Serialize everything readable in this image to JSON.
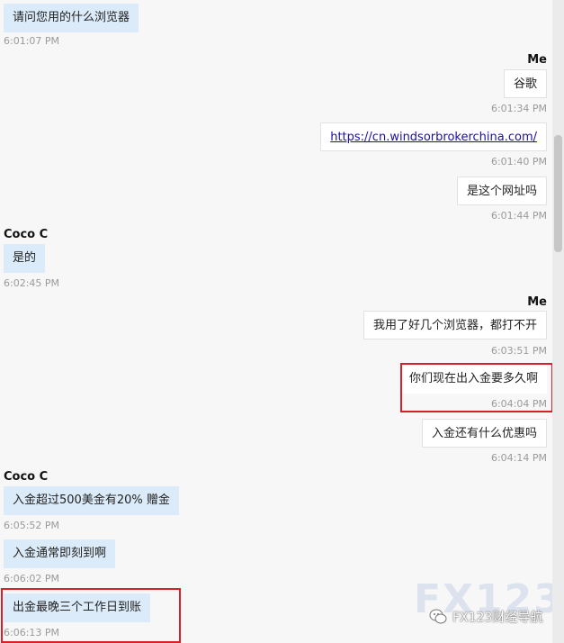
{
  "messages": [
    {
      "text": "请问您用的什么浏览器",
      "time": "6:01:07 PM"
    },
    {
      "sender": "Me",
      "text": "谷歌",
      "time": "6:01:34 PM"
    },
    {
      "link": "https://cn.windsorbrokerchina.com/",
      "time": "6:01:40 PM"
    },
    {
      "text": "是这个网址吗",
      "time": "6:01:44 PM"
    },
    {
      "sender": "Coco C",
      "text": "是的",
      "time": "6:02:45 PM"
    },
    {
      "sender": "Me",
      "text": "我用了好几个浏览器，都打不开",
      "time": "6:03:51 PM"
    },
    {
      "text": "你们现在出入金要多久啊",
      "time": "6:04:04 PM"
    },
    {
      "text": "入金还有什么优惠吗",
      "time": "6:04:14 PM"
    },
    {
      "sender": "Coco C",
      "text": "入金超过500美金有20% 赠金",
      "time": "6:05:52 PM"
    },
    {
      "text": "入金通常即刻到啊",
      "time": "6:06:02 PM"
    },
    {
      "text": "出金最晚三个工作日到账",
      "time": "6:06:13 PM"
    }
  ],
  "watermark": {
    "logo_text": "FX123",
    "caption": "FX123财经导航"
  },
  "colors": {
    "incoming_bubble": "#dcebf9",
    "outgoing_bubble": "#ffffff",
    "highlight": "#d9202a"
  }
}
